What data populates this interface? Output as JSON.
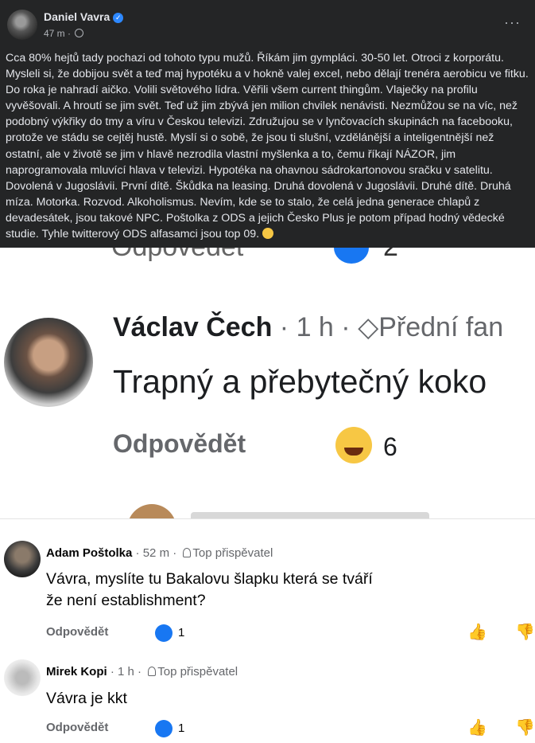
{
  "post": {
    "author": "Daniel Vavra",
    "time": "47 m",
    "more": "···",
    "body": "Cca 80% hejtů tady pochazi od tohoto typu mužů. Říkám jim gympláci. 30-50 let. Otroci z korporátu. Mysleli si, že dobijou svět a teď maj hypotéku a v hokně valej excel, nebo dělají trenéra aerobicu ve fitku. Do roka je nahradí aičko. Volili světového lídra. Věřili všem current thingům. Vlaječky na profilu vyvěšovali. A hroutí se jim svět. Teď už jim zbývá jen milion chvilek nenávisti. Nezmůžou se na víc, než podobný výkřiky do tmy a víru v Českou televizi. Združujou se v lynčovacích skupinách na facebooku, protože ve stádu se cejtěj hustě. Myslí si o sobě, že jsou ti slušní, vzdělánější a inteligentnější než ostatní, ale v životě se jim v hlavě nezrodila vlastní myšlenka a to, čemu říkají NÁZOR, jim naprogramovala mluvící hlava v televizi. Hypotéka na ohavnou sádrokartonovou sračku v satelitu. Dovolená v Jugoslávii. První dítě. Škůdka na leasing. Druhá dovolená v Jugoslávii. Druhé dítě. Druhá míza. Motorka. Rozvod. Alkoholismus. Nevím, kde se to stalo, že celá jedna generace chlapů z devadesátek, jsou takové NPC. Poštolka z ODS a jejich Česko Plus je potom případ hodný vědecké studie. Tyhle twitterový ODS alfasamci jsou top 09."
  },
  "zoom": {
    "cut_label": "Odpovědět",
    "cut_count": "2",
    "name": "Václav Čech",
    "meta": " · 1 h · ",
    "badge": "Přední fan",
    "comment": "Trapný a přebytečný koko",
    "reply": "Odpovědět",
    "reaction_count": "6"
  },
  "comments": [
    {
      "name": "Adam Poštolka",
      "time": "52 m",
      "badge": "Top přispěvatel",
      "text": "Vávra, myslíte tu Bakalovu šlapku která se tváří že není establishment?",
      "reply": "Odpovědět",
      "likes": "1"
    },
    {
      "name": "Mirek Kopi",
      "time": "1 h",
      "badge": "Top přispěvatel",
      "text": "Vávra je kkt",
      "reply": "Odpovědět",
      "likes": "1"
    }
  ],
  "icons": {
    "like": "thumbs-up-icon",
    "dislike": "thumbs-down-icon",
    "globe": "globe-icon",
    "verified": "verified-badge-icon"
  },
  "colors": {
    "dark_bg": "#242526",
    "accent": "#1877f2"
  }
}
